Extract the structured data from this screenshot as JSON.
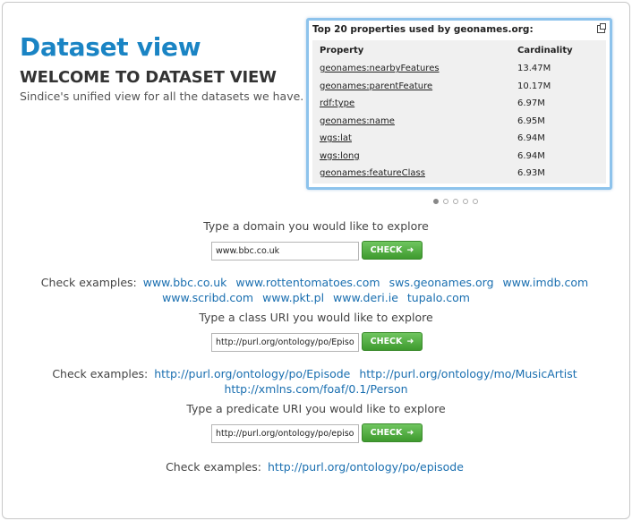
{
  "header": {
    "title": "Dataset view",
    "subtitle": "WELCOME TO DATASET VIEW",
    "tagline": "Sindice's unified view for all the datasets we have."
  },
  "widget": {
    "title": "Top 20 properties used by geonames.org:",
    "columns": [
      "Property",
      "Cardinality"
    ],
    "rows": [
      {
        "property": "geonames:nearbyFeatures",
        "cardinality": "13.47M"
      },
      {
        "property": "geonames:parentFeature",
        "cardinality": "10.17M"
      },
      {
        "property": "rdf:type",
        "cardinality": "6.97M"
      },
      {
        "property": "geonames:name",
        "cardinality": "6.95M"
      },
      {
        "property": "wgs:lat",
        "cardinality": "6.94M"
      },
      {
        "property": "wgs:long",
        "cardinality": "6.94M"
      },
      {
        "property": "geonames:featureClass",
        "cardinality": "6.93M"
      }
    ],
    "pages": 5,
    "active_page": 1
  },
  "domain_section": {
    "prompt": "Type a domain you would like to explore",
    "input_value": "www.bbc.co.uk",
    "button_label": "CHECK",
    "examples_label": "Check examples:",
    "examples_line1": [
      "www.bbc.co.uk",
      "www.rottentomatoes.com",
      "sws.geonames.org",
      "www.imdb.com"
    ],
    "examples_line2": [
      "www.scribd.com",
      "www.pkt.pl",
      "www.deri.ie",
      "tupalo.com"
    ]
  },
  "class_section": {
    "prompt": "Type a class URI you would like to explore",
    "input_value": "http://purl.org/ontology/po/Episode",
    "button_label": "CHECK",
    "examples_label": "Check examples:",
    "examples_line1": [
      "http://purl.org/ontology/po/Episode",
      "http://purl.org/ontology/mo/MusicArtist"
    ],
    "examples_line2": [
      "http://xmlns.com/foaf/0.1/Person"
    ]
  },
  "predicate_section": {
    "prompt": "Type a predicate URI you would like to explore",
    "input_value": "http://purl.org/ontology/po/episode",
    "button_label": "CHECK",
    "examples_label": "Check examples:",
    "examples_line1": [
      "http://purl.org/ontology/po/episode"
    ]
  },
  "colors": {
    "title": "#1a84c4",
    "link": "#1a6fb0",
    "button_green": "#4aa838",
    "widget_border": "#8dc3ec"
  },
  "icons": {
    "popout": "popout-icon",
    "button_arrow": "arrow-right-icon"
  }
}
